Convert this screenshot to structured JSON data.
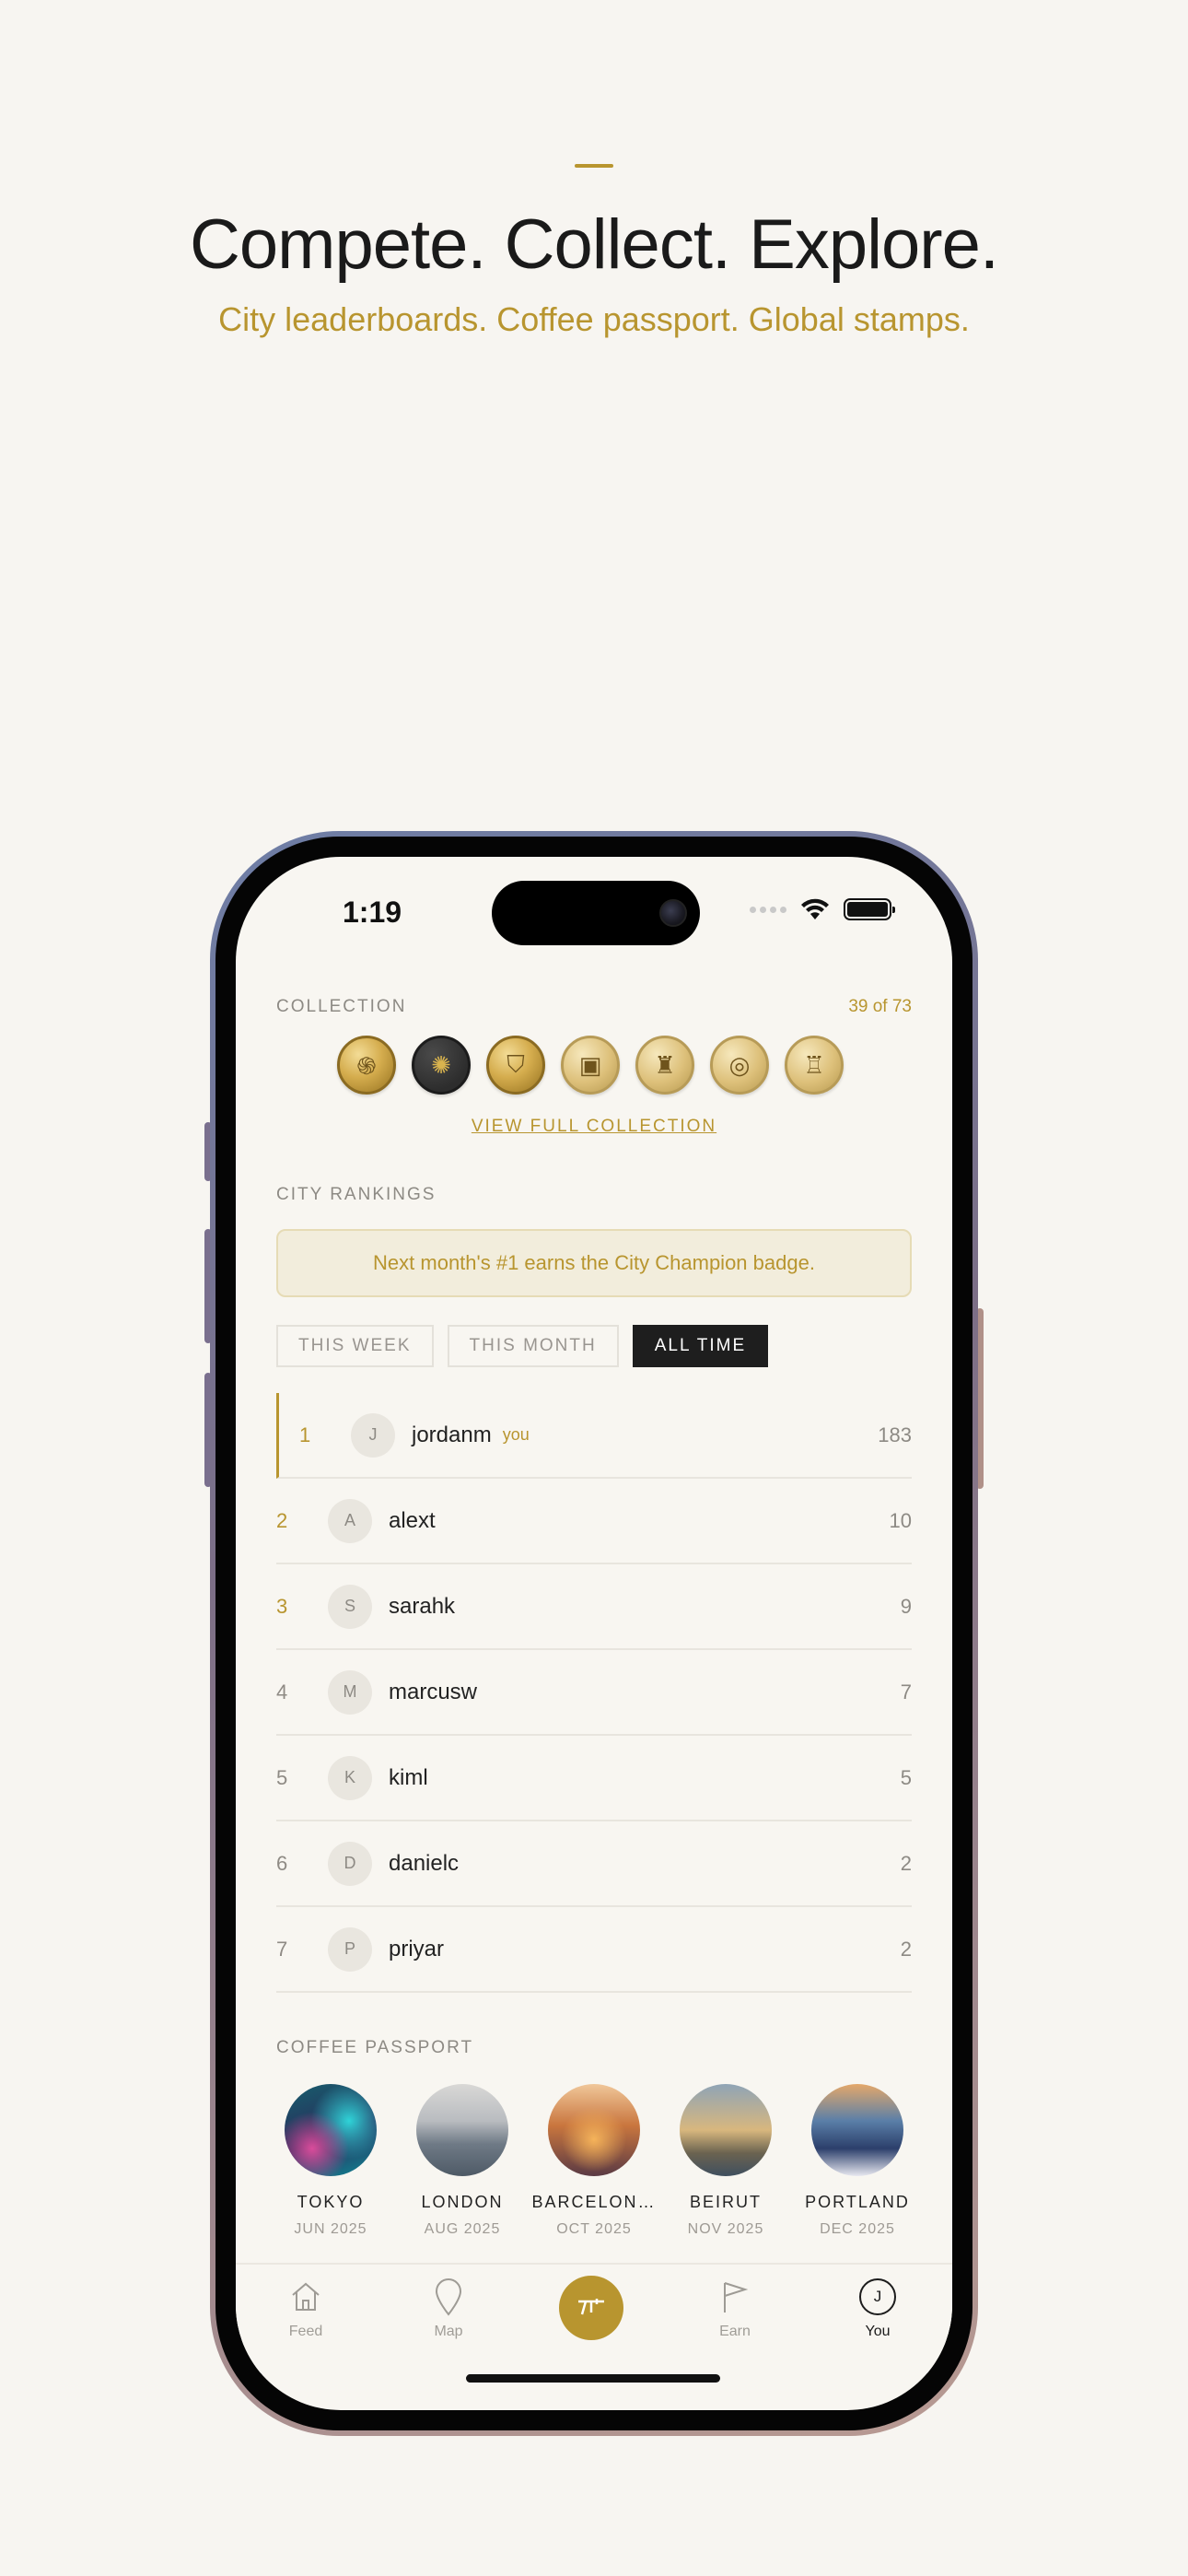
{
  "hero": {
    "headline": "Compete. Collect. Explore.",
    "subhead": "City leaderboards. Coffee passport. Global stamps."
  },
  "status_bar": {
    "time": "1:19",
    "icons": [
      "signal-dots-icon",
      "wifi-icon",
      "battery-icon"
    ]
  },
  "collection": {
    "label": "COLLECTION",
    "count": "39 of 73",
    "coin_icons": [
      "swirl-stamp-icon",
      "seal-stamp-icon",
      "shield-stamp-icon",
      "card-stamp-icon",
      "skyline-stamp-icon",
      "ring-stamp-icon",
      "city-stamp-icon"
    ],
    "view_link": "VIEW FULL COLLECTION"
  },
  "rankings": {
    "label": "CITY RANKINGS",
    "banner": "Next month's #1 earns the City Champion badge.",
    "tabs": [
      "THIS WEEK",
      "THIS MONTH",
      "ALL TIME"
    ],
    "active_tab": "ALL TIME",
    "rows": [
      {
        "rank": "1",
        "initial": "J",
        "name": "jordanm",
        "tag": "you",
        "score": "183"
      },
      {
        "rank": "2",
        "initial": "A",
        "name": "alext",
        "score": "10"
      },
      {
        "rank": "3",
        "initial": "S",
        "name": "sarahk",
        "score": "9"
      },
      {
        "rank": "4",
        "initial": "M",
        "name": "marcusw",
        "score": "7"
      },
      {
        "rank": "5",
        "initial": "K",
        "name": "kiml",
        "score": "5"
      },
      {
        "rank": "6",
        "initial": "D",
        "name": "danielc",
        "score": "2"
      },
      {
        "rank": "7",
        "initial": "P",
        "name": "priyar",
        "score": "2"
      }
    ]
  },
  "passport": {
    "label": "COFFEE PASSPORT",
    "stamps": [
      {
        "city": "TOKYO",
        "date": "JUN 2025"
      },
      {
        "city": "LONDON",
        "date": "AUG 2025"
      },
      {
        "city": "BARCELON…",
        "date": "OCT 2025"
      },
      {
        "city": "BEIRUT",
        "date": "NOV 2025"
      },
      {
        "city": "PORTLAND",
        "date": "DEC 2025"
      }
    ]
  },
  "tab_bar": {
    "feed": "Feed",
    "map": "Map",
    "earn": "Earn",
    "you": "You",
    "you_initial": "J",
    "active": "You"
  },
  "colors": {
    "accent": "#b8952f",
    "background": "#f7f5f1",
    "dark": "#1e1e1e"
  }
}
